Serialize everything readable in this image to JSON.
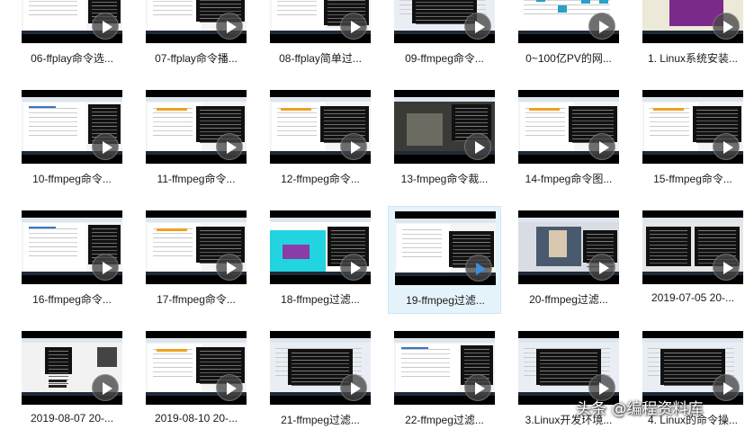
{
  "items": [
    {
      "title": "06-ffplay命令选...",
      "style": "browser"
    },
    {
      "title": "07-ffplay命令播...",
      "style": "slides"
    },
    {
      "title": "08-ffplay简单过...",
      "style": "doc"
    },
    {
      "title": "09-ffmpeg命令...",
      "style": "terminal"
    },
    {
      "title": "0~100亿PV的网...",
      "style": "diagram"
    },
    {
      "title": "1. Linux系统安装...",
      "style": "vm"
    },
    {
      "title": "10-ffmpeg命令...",
      "style": "browser"
    },
    {
      "title": "11-ffmpeg命令...",
      "style": "slides"
    },
    {
      "title": "12-ffmpeg命令...",
      "style": "slides"
    },
    {
      "title": "13-fmpeg命令裁...",
      "style": "video"
    },
    {
      "title": "14-fmpeg命令图...",
      "style": "slides"
    },
    {
      "title": "15-ffmpeg命令...",
      "style": "slides"
    },
    {
      "title": "16-ffmpeg命令...",
      "style": "browser"
    },
    {
      "title": "17-ffmpeg命令...",
      "style": "slides"
    },
    {
      "title": "18-ffmpeg过滤...",
      "style": "cyan"
    },
    {
      "title": "19-ffmpeg过滤...",
      "style": "doc",
      "selected": true
    },
    {
      "title": "20-ffmpeg过滤...",
      "style": "photo"
    },
    {
      "title": "2019-07-05 20-...",
      "style": "code"
    },
    {
      "title": "2019-08-07 20-...",
      "style": "qr"
    },
    {
      "title": "2019-08-10 20-...",
      "style": "slides"
    },
    {
      "title": "21-ffmpeg过滤...",
      "style": "terminal"
    },
    {
      "title": "22-ffmpeg过滤...",
      "style": "browser"
    },
    {
      "title": "3.Linux开发环境...",
      "style": "terminal"
    },
    {
      "title": "4. Linux的命令操...",
      "style": "terminal"
    }
  ],
  "watermark": "头条 @编程资料库"
}
